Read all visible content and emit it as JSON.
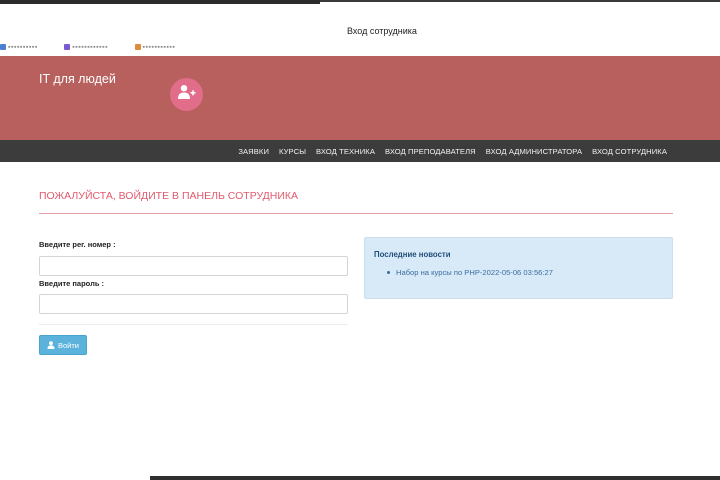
{
  "browser": {
    "tab_title": "Вход сотрудника",
    "bookmarks": [
      "▪▪▪▪▪▪▪▪▪▪",
      "▪▪▪▪▪▪▪▪▪▪▪▪",
      "▪▪▪▪▪▪▪▪▪▪▪"
    ]
  },
  "header": {
    "brand": "IT для людей",
    "logo_icon": "add-user-icon",
    "logo_color": "#e16d8a",
    "background": "#b8605e"
  },
  "nav": {
    "items": [
      {
        "label": "ЗАЯВКИ"
      },
      {
        "label": "КУРСЫ"
      },
      {
        "label": "ВХОД ТЕХНИКА"
      },
      {
        "label": "ВХОД ПРЕПОДАВАТЕЛЯ"
      },
      {
        "label": "ВХОД АДМИНИСТРАТОРА"
      },
      {
        "label": "ВХОД СОТРУДНИКА"
      }
    ]
  },
  "main": {
    "title": "ПОЖАЛУЙСТА, ВОЙДИТЕ В ПАНЕЛЬ СОТРУДНИКА",
    "accent_color": "#e05a6e",
    "form": {
      "reg_label": "Введите рег. номер :",
      "reg_value": "",
      "reg_placeholder": "",
      "pass_label": "Введите пароль :",
      "pass_value": "",
      "pass_placeholder": "",
      "submit_label": "Войти",
      "submit_icon": "user-icon"
    },
    "news": {
      "title": "Последние новости",
      "items": [
        {
          "label": "Набор на курсы по PHP-2022-05-06 03:56:27"
        }
      ]
    }
  }
}
